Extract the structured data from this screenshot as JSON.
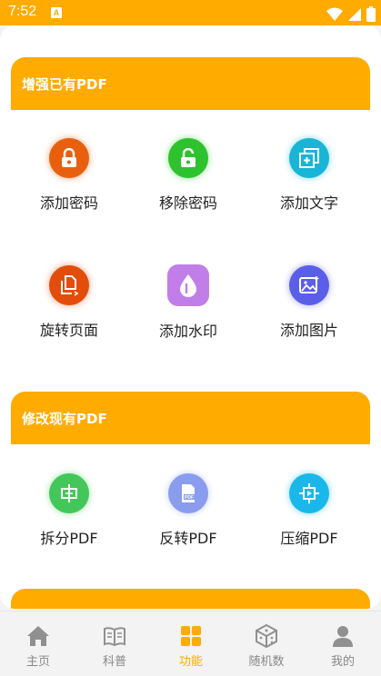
{
  "status_bar": {
    "time": "7:52",
    "notification_icon": "A"
  },
  "sections": [
    {
      "title": "增强已有PDF",
      "tools": [
        {
          "label": "添加密码",
          "icon": "lock-icon",
          "color": "#e8600e"
        },
        {
          "label": "移除密码",
          "icon": "unlock-icon",
          "color": "#2ec22e"
        },
        {
          "label": "添加文字",
          "icon": "add-text-icon",
          "color": "#18b5d6"
        },
        {
          "label": "旋转页面",
          "icon": "rotate-page-icon",
          "color": "#e24d0c"
        },
        {
          "label": "添加水印",
          "icon": "watermark-icon",
          "color": "#c27ee8"
        },
        {
          "label": "添加图片",
          "icon": "add-image-icon",
          "color": "#5b5ee8"
        }
      ]
    },
    {
      "title": "修改现有PDF",
      "tools": [
        {
          "label": "拆分PDF",
          "icon": "split-icon",
          "color": "#44c75a"
        },
        {
          "label": "反转PDF",
          "icon": "reverse-pdf-icon",
          "color": "#8a9cee"
        },
        {
          "label": "压缩PDF",
          "icon": "compress-icon",
          "color": "#1ab8ea"
        }
      ]
    }
  ],
  "bottom_nav": [
    {
      "label": "主页",
      "icon": "home-icon",
      "active": false
    },
    {
      "label": "科普",
      "icon": "book-icon",
      "active": false
    },
    {
      "label": "功能",
      "icon": "grid-icon",
      "active": true
    },
    {
      "label": "随机数",
      "icon": "dice-icon",
      "active": false
    },
    {
      "label": "我的",
      "icon": "user-icon",
      "active": false
    }
  ],
  "colors": {
    "accent": "#ffab00",
    "inactive": "#888888"
  }
}
